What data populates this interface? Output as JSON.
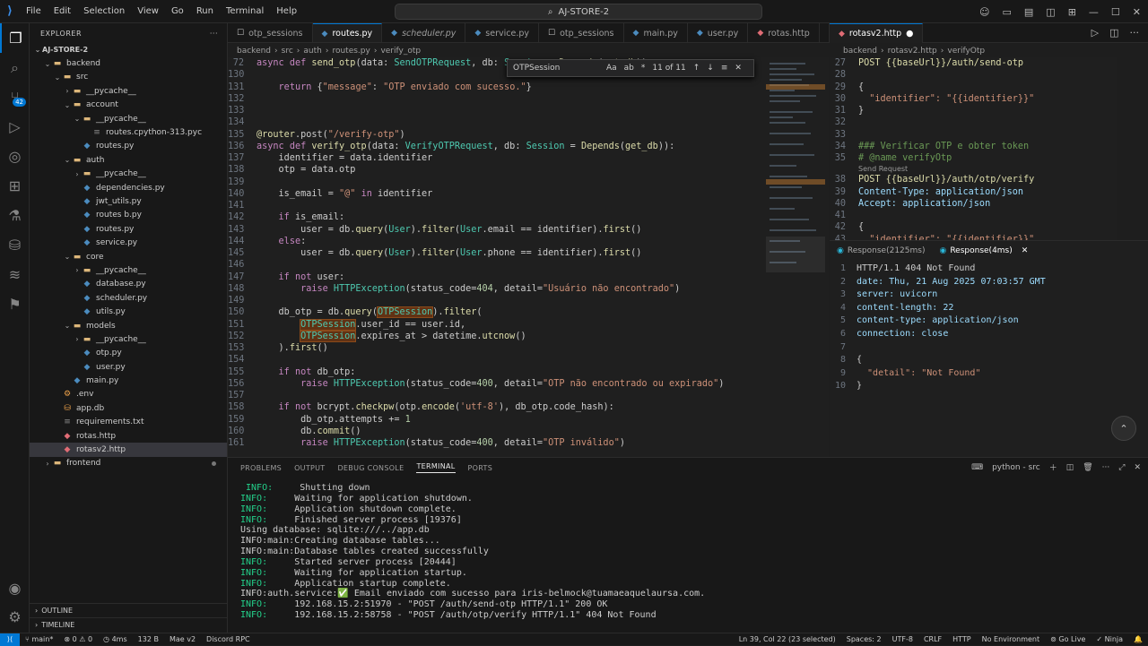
{
  "menu": [
    "File",
    "Edit",
    "Selection",
    "View",
    "Go",
    "Run",
    "Terminal",
    "Help"
  ],
  "search": "AJ-STORE-2",
  "explorer": {
    "title": "EXPLORER",
    "root": "AJ-STORE-2",
    "outline": "OUTLINE",
    "timeline": "TIMELINE",
    "items": [
      {
        "label": "backend",
        "depth": 1,
        "kind": "folder",
        "open": true
      },
      {
        "label": "src",
        "depth": 2,
        "kind": "folder",
        "open": true
      },
      {
        "label": "__pycache__",
        "depth": 3,
        "kind": "folder",
        "open": false
      },
      {
        "label": "account",
        "depth": 3,
        "kind": "folder",
        "open": true
      },
      {
        "label": "__pycache__",
        "depth": 4,
        "kind": "folder",
        "open": true
      },
      {
        "label": "routes.cpython-313.pyc",
        "depth": 5,
        "kind": "file"
      },
      {
        "label": "routes.py",
        "depth": 4,
        "kind": "py"
      },
      {
        "label": "auth",
        "depth": 3,
        "kind": "folder",
        "open": true
      },
      {
        "label": "__pycache__",
        "depth": 4,
        "kind": "folder",
        "open": false
      },
      {
        "label": "dependencies.py",
        "depth": 4,
        "kind": "py"
      },
      {
        "label": "jwt_utils.py",
        "depth": 4,
        "kind": "py"
      },
      {
        "label": "routes b.py",
        "depth": 4,
        "kind": "py"
      },
      {
        "label": "routes.py",
        "depth": 4,
        "kind": "py"
      },
      {
        "label": "service.py",
        "depth": 4,
        "kind": "py"
      },
      {
        "label": "core",
        "depth": 3,
        "kind": "folder",
        "open": true
      },
      {
        "label": "__pycache__",
        "depth": 4,
        "kind": "folder",
        "open": false
      },
      {
        "label": "database.py",
        "depth": 4,
        "kind": "py"
      },
      {
        "label": "scheduler.py",
        "depth": 4,
        "kind": "py"
      },
      {
        "label": "utils.py",
        "depth": 4,
        "kind": "py"
      },
      {
        "label": "models",
        "depth": 3,
        "kind": "folder",
        "open": true
      },
      {
        "label": "__pycache__",
        "depth": 4,
        "kind": "folder",
        "open": false
      },
      {
        "label": "otp.py",
        "depth": 4,
        "kind": "py"
      },
      {
        "label": "user.py",
        "depth": 4,
        "kind": "py"
      },
      {
        "label": "main.py",
        "depth": 3,
        "kind": "py"
      },
      {
        "label": ".env",
        "depth": 2,
        "kind": "env"
      },
      {
        "label": "app.db",
        "depth": 2,
        "kind": "db"
      },
      {
        "label": "requirements.txt",
        "depth": 2,
        "kind": "txt"
      },
      {
        "label": "rotas.http",
        "depth": 2,
        "kind": "http"
      },
      {
        "label": "rotasv2.http",
        "depth": 2,
        "kind": "http",
        "selected": true
      },
      {
        "label": "frontend",
        "depth": 1,
        "kind": "folder",
        "open": false,
        "dot": true
      }
    ]
  },
  "tabs1": [
    {
      "label": "otp_sessions",
      "icon": "☐"
    },
    {
      "label": "routes.py",
      "icon": "◆",
      "active": true
    },
    {
      "label": "scheduler.py",
      "icon": "◆",
      "italic": true
    },
    {
      "label": "service.py",
      "icon": "◆"
    },
    {
      "label": "otp_sessions",
      "icon": "☐"
    },
    {
      "label": "main.py",
      "icon": "◆"
    },
    {
      "label": "user.py",
      "icon": "◆"
    },
    {
      "label": "rotas.http",
      "icon": "◆"
    }
  ],
  "breadcrumb1": [
    "backend",
    "src",
    "auth",
    "routes.py",
    "verify_otp"
  ],
  "find": {
    "value": "OTPSession",
    "count": "11 of 11",
    "opts": [
      "Aa",
      "ab",
      "*"
    ]
  },
  "code1": [
    {
      "n": "72",
      "t": "async def send_otp(data: SendOTPRequest, db: Session = Depends(get_db)):"
    },
    {
      "n": "130",
      "t": ""
    },
    {
      "n": "131",
      "t": "    return {\"message\": \"OTP enviado com sucesso.\"}"
    },
    {
      "n": "132",
      "t": ""
    },
    {
      "n": "133",
      "t": ""
    },
    {
      "n": "134",
      "t": ""
    },
    {
      "n": "135",
      "t": "@router.post(\"/verify-otp\")"
    },
    {
      "n": "136",
      "t": "async def verify_otp(data: VerifyOTPRequest, db: Session = Depends(get_db)):"
    },
    {
      "n": "137",
      "t": "    identifier = data.identifier"
    },
    {
      "n": "138",
      "t": "    otp = data.otp"
    },
    {
      "n": "139",
      "t": ""
    },
    {
      "n": "140",
      "t": "    is_email = \"@\" in identifier"
    },
    {
      "n": "141",
      "t": ""
    },
    {
      "n": "142",
      "t": "    if is_email:"
    },
    {
      "n": "143",
      "t": "        user = db.query(User).filter(User.email == identifier).first()"
    },
    {
      "n": "144",
      "t": "    else:"
    },
    {
      "n": "145",
      "t": "        user = db.query(User).filter(User.phone == identifier).first()"
    },
    {
      "n": "146",
      "t": ""
    },
    {
      "n": "147",
      "t": "    if not user:"
    },
    {
      "n": "148",
      "t": "        raise HTTPException(status_code=404, detail=\"Usuário não encontrado\")"
    },
    {
      "n": "149",
      "t": ""
    },
    {
      "n": "150",
      "t": "    db_otp = db.query(OTPSession).filter("
    },
    {
      "n": "151",
      "t": "        OTPSession.user_id == user.id,"
    },
    {
      "n": "152",
      "t": "        OTPSession.expires_at > datetime.utcnow()"
    },
    {
      "n": "153",
      "t": "    ).first()"
    },
    {
      "n": "154",
      "t": ""
    },
    {
      "n": "155",
      "t": "    if not db_otp:"
    },
    {
      "n": "156",
      "t": "        raise HTTPException(status_code=400, detail=\"OTP não encontrado ou expirado\")"
    },
    {
      "n": "157",
      "t": ""
    },
    {
      "n": "158",
      "t": "    if not bcrypt.checkpw(otp.encode('utf-8'), db_otp.code_hash):"
    },
    {
      "n": "159",
      "t": "        db_otp.attempts += 1"
    },
    {
      "n": "160",
      "t": "        db.commit()"
    },
    {
      "n": "161",
      "t": "        raise HTTPException(status_code=400, detail=\"OTP inválido\")"
    }
  ],
  "tabs2": [
    {
      "label": "rotasv2.http",
      "active": true,
      "modified": true
    }
  ],
  "breadcrumb2": [
    "backend",
    "rotasv2.http",
    "verifyOtp"
  ],
  "code2": [
    {
      "n": "27",
      "t": "POST {{baseUrl}}/auth/send-otp"
    },
    {
      "n": "28",
      "t": ""
    },
    {
      "n": "29",
      "t": "{"
    },
    {
      "n": "30",
      "t": "  \"identifier\": \"{{identifier}}\""
    },
    {
      "n": "31",
      "t": "}"
    },
    {
      "n": "32",
      "t": ""
    },
    {
      "n": "33",
      "t": ""
    },
    {
      "n": "34",
      "t": "### Verificar OTP e obter token"
    },
    {
      "n": "35",
      "t": "# @name verifyOtp"
    },
    {
      "n": "",
      "t": "Send Request"
    },
    {
      "n": "38",
      "t": "POST {{baseUrl}}/auth/otp/verify"
    },
    {
      "n": "39",
      "t": "Content-Type: application/json"
    },
    {
      "n": "40",
      "t": "Accept: application/json"
    },
    {
      "n": "41",
      "t": ""
    },
    {
      "n": "42",
      "t": "{"
    },
    {
      "n": "43",
      "t": "  \"identifier\": \"{{identifier}}\""
    }
  ],
  "responseTabs": [
    "Response(2125ms)",
    "Response(4ms)"
  ],
  "response": [
    {
      "n": "1",
      "t": "HTTP/1.1 404 Not Found"
    },
    {
      "n": "2",
      "t": "date: Thu, 21 Aug 2025 07:03:57 GMT"
    },
    {
      "n": "3",
      "t": "server: uvicorn"
    },
    {
      "n": "4",
      "t": "content-length: 22"
    },
    {
      "n": "5",
      "t": "content-type: application/json"
    },
    {
      "n": "6",
      "t": "connection: close"
    },
    {
      "n": "7",
      "t": ""
    },
    {
      "n": "8",
      "t": "{"
    },
    {
      "n": "9",
      "t": "  \"detail\": \"Not Found\""
    },
    {
      "n": "10",
      "t": "}"
    }
  ],
  "panelTabs": [
    "PROBLEMS",
    "OUTPUT",
    "DEBUG CONSOLE",
    "TERMINAL",
    "PORTS"
  ],
  "terminalName": "python - src",
  "terminal": [
    {
      "p": " INFO:",
      "t": "     Shutting down"
    },
    {
      "p": "INFO:",
      "t": "     Waiting for application shutdown."
    },
    {
      "p": "INFO:",
      "t": "     Application shutdown complete."
    },
    {
      "p": "INFO:",
      "t": "     Finished server process [19376]"
    },
    {
      "p": "",
      "t": "Using database: sqlite:///../app.db"
    },
    {
      "p": "",
      "t": "INFO:main:Creating database tables..."
    },
    {
      "p": "",
      "t": "INFO:main:Database tables created successfully"
    },
    {
      "p": "INFO:",
      "t": "     Started server process [20444]"
    },
    {
      "p": "INFO:",
      "t": "     Waiting for application startup."
    },
    {
      "p": "INFO:",
      "t": "     Application startup complete."
    },
    {
      "p": "",
      "t": "INFO:auth.service:✅ Email enviado com sucesso para iris-belmock@tuamaeaquelaursa.com."
    },
    {
      "p": "INFO:",
      "t": "     192.168.15.2:51970 - \"POST /auth/send-otp HTTP/1.1\" 200 OK"
    },
    {
      "p": "INFO:",
      "t": "     192.168.15.2:58758 - \"POST /auth/otp/verify HTTP/1.1\" 404 Not Found"
    }
  ],
  "status": {
    "branch": "main*",
    "errors": "0",
    "warnings": "0",
    "time": "4ms",
    "size": "132 B",
    "mae": "Mae v2",
    "discord": "Discord RPC",
    "cursor": "Ln 39, Col 22 (23 selected)",
    "spaces": "Spaces: 2",
    "encoding": "UTF-8",
    "eol": "CRLF",
    "lang": "HTTP",
    "env": "No Environment",
    "golive": "Go Live",
    "ninja": "Ninja"
  }
}
